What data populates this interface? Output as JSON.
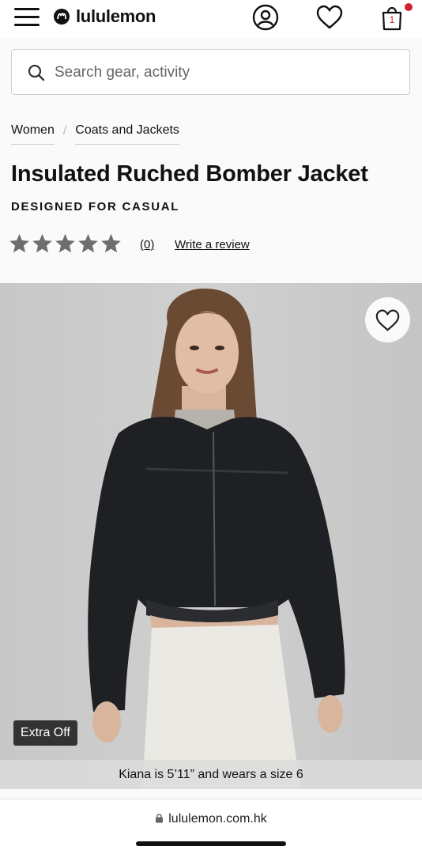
{
  "header": {
    "brand": "lululemon",
    "cart_count": "1",
    "accent_color": "#d22030",
    "icons": [
      "menu-icon",
      "lululemon-logo-icon",
      "account-icon",
      "heart-icon",
      "shopping-bag-icon"
    ]
  },
  "search": {
    "placeholder": "Search gear, activity",
    "value": ""
  },
  "breadcrumbs": [
    {
      "label": "Women"
    },
    {
      "label": "Coats and Jackets"
    }
  ],
  "product": {
    "title": "Insulated Ruched Bomber Jacket",
    "designed_for": "DESIGNED FOR CASUAL",
    "rating": {
      "stars_filled": 0,
      "stars_total": 5,
      "review_count_label": "(0)",
      "write_review_label": "Write a review"
    },
    "image": {
      "badge": "Extra Off",
      "caption": "Kiana is 5’11” and wears a size 6"
    }
  },
  "browser": {
    "url": "lululemon.com.hk"
  }
}
